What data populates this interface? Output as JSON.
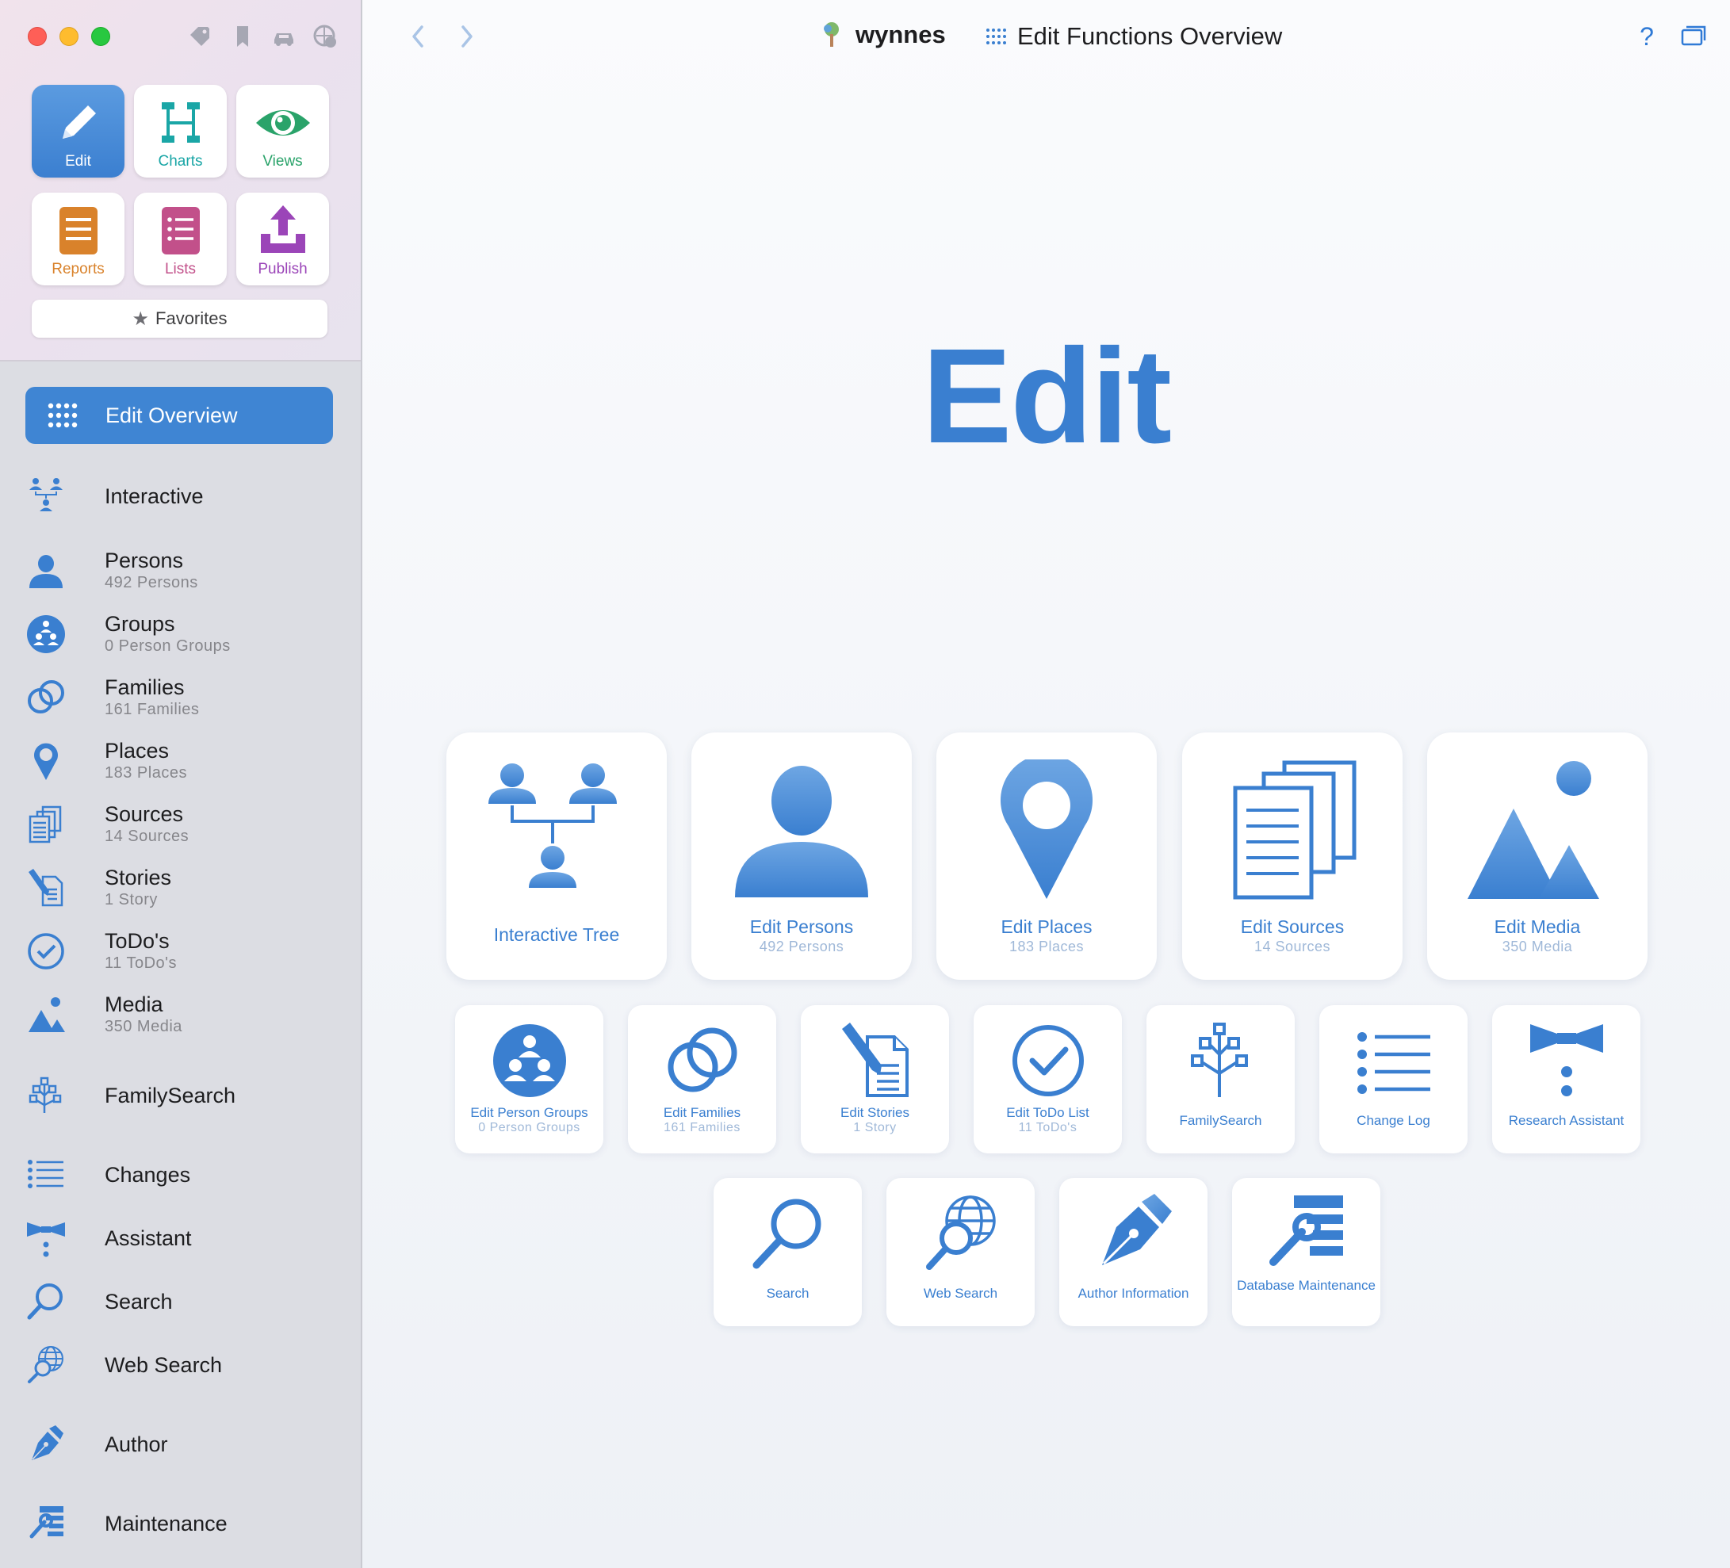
{
  "window": {
    "database_name": "wynnes",
    "page_title": "Edit Functions Overview",
    "help_label": "?"
  },
  "modes": [
    {
      "label": "Edit",
      "icon": "pencil-icon",
      "color": "#ffffff",
      "active": true
    },
    {
      "label": "Charts",
      "icon": "charts-icon",
      "color": "#1aa6a6"
    },
    {
      "label": "Views",
      "icon": "eye-icon",
      "color": "#2aa36a"
    },
    {
      "label": "Reports",
      "icon": "reports-icon",
      "color": "#d9822b"
    },
    {
      "label": "Lists",
      "icon": "lists-icon",
      "color": "#c2508a"
    },
    {
      "label": "Publish",
      "icon": "publish-icon",
      "color": "#9b45b8"
    }
  ],
  "favorites": {
    "label": "Favorites",
    "icon": "star-icon"
  },
  "sidebar": {
    "items": [
      {
        "title": "Edit Overview",
        "sub": "",
        "icon": "grid-icon"
      },
      {
        "title": "Interactive",
        "sub": "",
        "icon": "interactive-tree-icon"
      },
      {
        "title": "Persons",
        "sub": "492 Persons",
        "icon": "person-icon"
      },
      {
        "title": "Groups",
        "sub": "0 Person Groups",
        "icon": "groups-icon"
      },
      {
        "title": "Families",
        "sub": "161 Families",
        "icon": "rings-icon"
      },
      {
        "title": "Places",
        "sub": "183 Places",
        "icon": "pin-icon"
      },
      {
        "title": "Sources",
        "sub": "14 Sources",
        "icon": "sources-icon"
      },
      {
        "title": "Stories",
        "sub": "1 Story",
        "icon": "stories-icon"
      },
      {
        "title": "ToDo's",
        "sub": "11 ToDo's",
        "icon": "todo-icon"
      },
      {
        "title": "Media",
        "sub": "350 Media",
        "icon": "media-icon"
      },
      {
        "title": "FamilySearch",
        "sub": "",
        "icon": "familysearch-icon"
      },
      {
        "title": "Changes",
        "sub": "",
        "icon": "change-log-icon"
      },
      {
        "title": "Assistant",
        "sub": "",
        "icon": "assistant-icon"
      },
      {
        "title": "Search",
        "sub": "",
        "icon": "search-icon"
      },
      {
        "title": "Web Search",
        "sub": "",
        "icon": "web-search-icon"
      },
      {
        "title": "Author",
        "sub": "",
        "icon": "author-icon"
      },
      {
        "title": "Maintenance",
        "sub": "",
        "icon": "maintenance-icon"
      }
    ]
  },
  "hero": {
    "title": "Edit"
  },
  "big_cards": [
    {
      "title": "Interactive Tree",
      "sub": "",
      "icon": "interactive-tree-icon"
    },
    {
      "title": "Edit Persons",
      "sub": "492 Persons",
      "icon": "person-icon"
    },
    {
      "title": "Edit Places",
      "sub": "183 Places",
      "icon": "pin-icon"
    },
    {
      "title": "Edit Sources",
      "sub": "14 Sources",
      "icon": "sources-icon"
    },
    {
      "title": "Edit Media",
      "sub": "350 Media",
      "icon": "media-icon"
    }
  ],
  "small_cards": [
    {
      "title": "Edit Person Groups",
      "sub": "0 Person Groups",
      "icon": "groups-icon"
    },
    {
      "title": "Edit Families",
      "sub": "161 Families",
      "icon": "rings-icon"
    },
    {
      "title": "Edit Stories",
      "sub": "1 Story",
      "icon": "stories-icon"
    },
    {
      "title": "Edit ToDo List",
      "sub": "11 ToDo's",
      "icon": "todo-icon"
    },
    {
      "title": "FamilySearch",
      "sub": "",
      "icon": "familysearch-icon"
    },
    {
      "title": "Change Log",
      "sub": "",
      "icon": "change-log-icon"
    },
    {
      "title": "Research Assistant",
      "sub": "",
      "icon": "assistant-icon"
    },
    {
      "title": "Search",
      "sub": "",
      "icon": "search-icon"
    },
    {
      "title": "Web Search",
      "sub": "",
      "icon": "web-search-icon"
    },
    {
      "title": "Author Information",
      "sub": "",
      "icon": "author-icon"
    },
    {
      "title": "Database Maintenance",
      "sub": "",
      "icon": "maintenance-icon"
    }
  ],
  "colors": {
    "accent": "#3a7fd0",
    "sidebar_bg": "#dcdde3",
    "selected_bg": "#3f85d3"
  }
}
